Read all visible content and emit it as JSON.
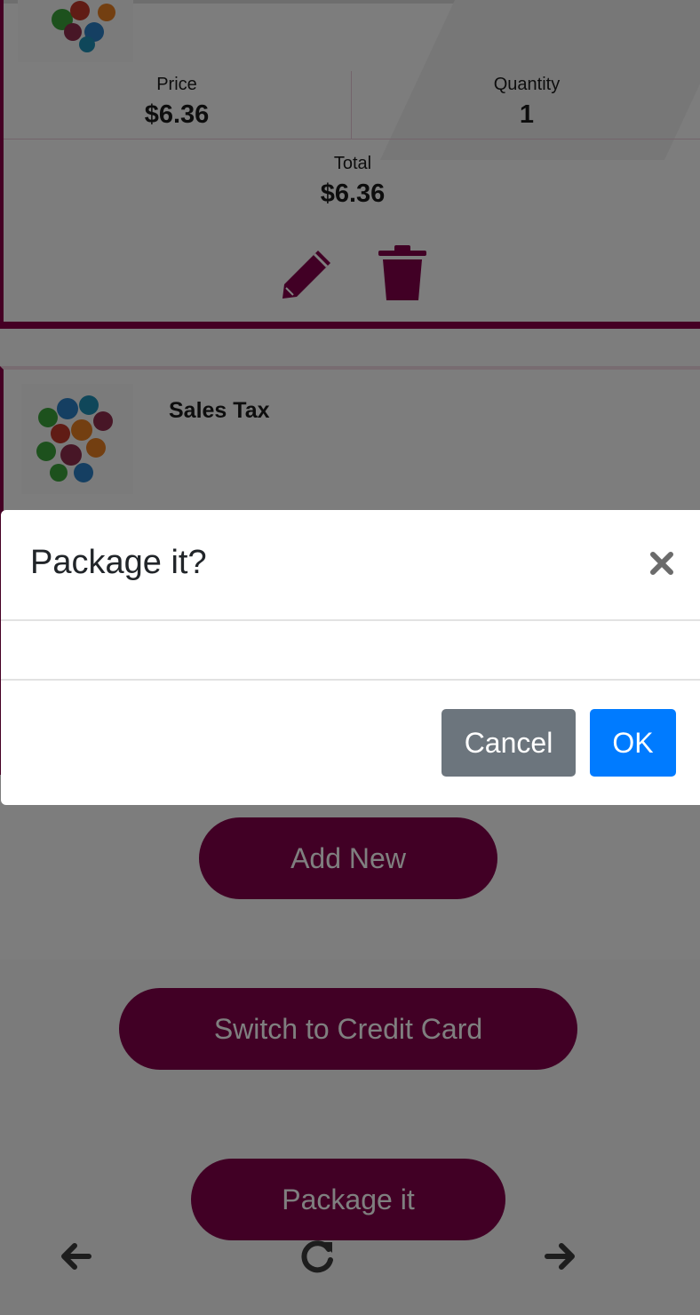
{
  "cart_item": {
    "price_label": "Price",
    "price": "$6.36",
    "quantity_label": "Quantity",
    "quantity": "1",
    "total_label": "Total",
    "total": "$6.36",
    "edit_icon": "pencil-icon",
    "delete_icon": "trash-icon"
  },
  "tax_item": {
    "name": "Sales Tax"
  },
  "actions": {
    "add_new": "Add New",
    "switch_payment": "Switch to Credit Card",
    "package": "Package it"
  },
  "bottom_nav": {
    "back_icon": "arrow-left-icon",
    "reload_icon": "reload-icon",
    "forward_icon": "arrow-right-icon"
  },
  "modal": {
    "title": "Package it?",
    "close_icon": "close-icon",
    "cancel_label": "Cancel",
    "ok_label": "OK"
  },
  "colors": {
    "brand": "#82004a",
    "cancel": "#6c757d",
    "ok": "#007bff"
  }
}
